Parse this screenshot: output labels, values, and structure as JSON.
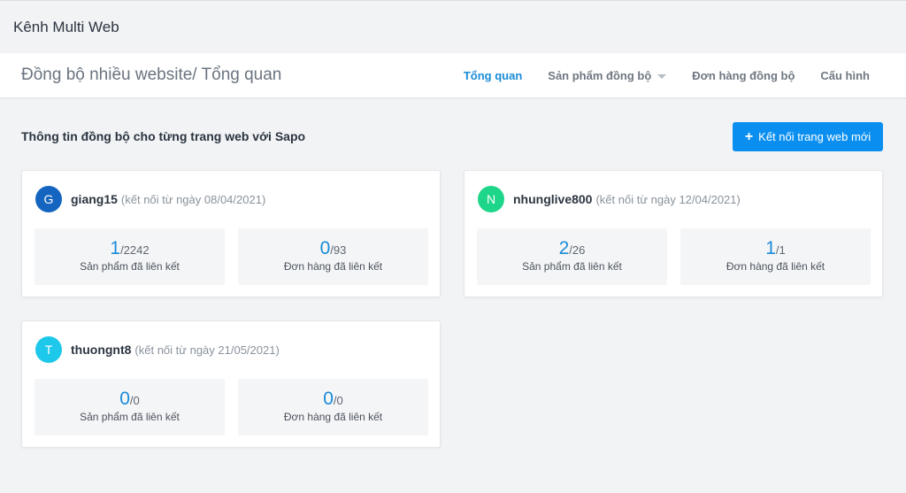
{
  "app": {
    "title": "Kênh Multi Web"
  },
  "header": {
    "breadcrumb": "Đồng bộ nhiều website/ Tổng quan",
    "tabs": [
      {
        "label": "Tổng quan",
        "active": true
      },
      {
        "label": "Sản phẩm đồng bộ",
        "has_dropdown": true
      },
      {
        "label": "Đơn hàng đồng bộ"
      },
      {
        "label": "Cấu hình"
      }
    ]
  },
  "main": {
    "section_title": "Thông tin đồng bộ cho từng trang web với Sapo",
    "connect_button": {
      "icon": "plus-icon",
      "label": "Kết nối trang web mới"
    },
    "sites": [
      {
        "initial": "G",
        "avatar_color": "#1565c0",
        "name": "giang15",
        "connected_since": "(kết nối từ ngày 08/04/2021)",
        "products": {
          "linked": "1",
          "total": "/2242",
          "label": "Sản phẩm đã liên kết"
        },
        "orders": {
          "linked": "0",
          "total": "/93",
          "label": "Đơn hàng đã liên kết"
        }
      },
      {
        "initial": "N",
        "avatar_color": "#1ed68a",
        "name": "nhunglive800",
        "connected_since": "(kết nối từ ngày 12/04/2021)",
        "products": {
          "linked": "2",
          "total": "/26",
          "label": "Sản phẩm đã liên kết"
        },
        "orders": {
          "linked": "1",
          "total": "/1",
          "label": "Đơn hàng đã liên kết"
        }
      },
      {
        "initial": "T",
        "avatar_color": "#1ec8ea",
        "name": "thuongnt8",
        "connected_since": "(kết nối từ ngày 21/05/2021)",
        "products": {
          "linked": "0",
          "total": "/0",
          "label": "Sản phẩm đã liên kết"
        },
        "orders": {
          "linked": "0",
          "total": "/0",
          "label": "Đơn hàng đã liên kết"
        }
      }
    ]
  },
  "colors": {
    "accent": "#0a8ff0",
    "active_tab": "#1a8bd8"
  }
}
